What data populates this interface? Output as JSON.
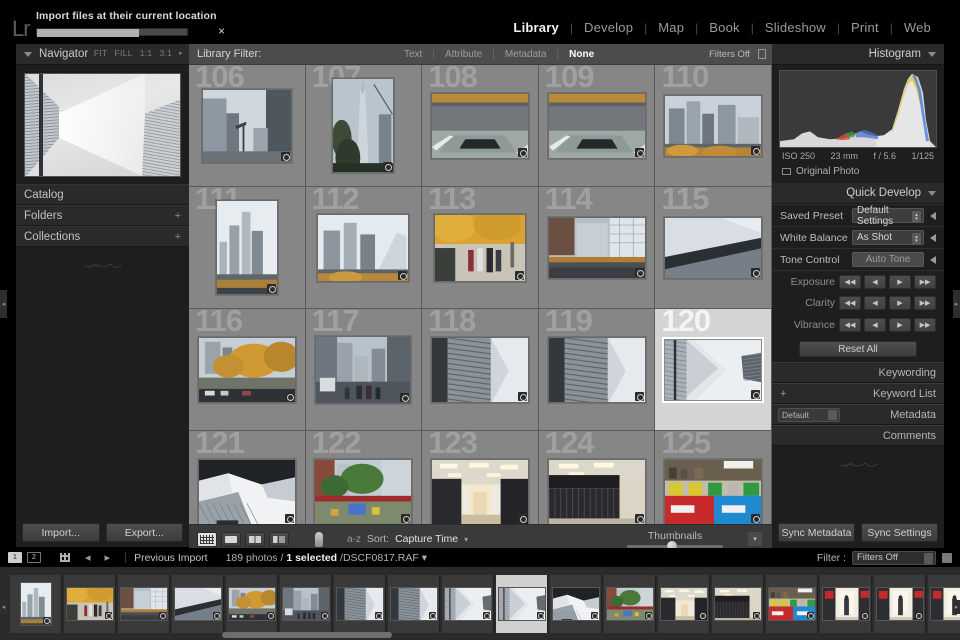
{
  "app": {
    "logo": "Lr"
  },
  "import_status": {
    "label": "Import files at their current location",
    "progress_percent": 68,
    "close_icon": "×"
  },
  "modules": {
    "items": [
      {
        "label": "Library",
        "active": true
      },
      {
        "label": "Develop",
        "active": false
      },
      {
        "label": "Map",
        "active": false
      },
      {
        "label": "Book",
        "active": false
      },
      {
        "label": "Slideshow",
        "active": false
      },
      {
        "label": "Print",
        "active": false
      },
      {
        "label": "Web",
        "active": false
      }
    ],
    "separator": "|"
  },
  "left_panel": {
    "navigator": {
      "title": "Navigator",
      "zoom_levels": [
        "FIT",
        "FILL",
        "1:1",
        "3:1"
      ],
      "more_arrow": "▸"
    },
    "sections": [
      {
        "label": "Catalog",
        "plus": ""
      },
      {
        "label": "Folders",
        "plus": "+"
      },
      {
        "label": "Collections",
        "plus": "+"
      }
    ],
    "buttons": {
      "import": "Import...",
      "export": "Export..."
    }
  },
  "library_filter": {
    "label": "Library Filter:",
    "tabs": [
      {
        "label": "Text",
        "active": false
      },
      {
        "label": "Attribute",
        "active": false
      },
      {
        "label": "Metadata",
        "active": false
      },
      {
        "label": "None",
        "active": true
      }
    ],
    "filters_off": "Filters Off"
  },
  "grid": {
    "cells": [
      {
        "index": "106",
        "selected": false,
        "kind": "buildings-crane"
      },
      {
        "index": "107",
        "selected": false,
        "kind": "tower-portrait"
      },
      {
        "index": "108",
        "selected": false,
        "kind": "memorial-pool"
      },
      {
        "index": "109",
        "selected": false,
        "kind": "memorial-pool"
      },
      {
        "index": "110",
        "selected": false,
        "kind": "skyline-autumn"
      },
      {
        "index": "111",
        "selected": false,
        "kind": "towers-portrait"
      },
      {
        "index": "112",
        "selected": false,
        "kind": "towers-wide"
      },
      {
        "index": "113",
        "selected": false,
        "kind": "walkway-people"
      },
      {
        "index": "114",
        "selected": false,
        "kind": "glass-facade"
      },
      {
        "index": "115",
        "selected": false,
        "kind": "abstract-wedge"
      },
      {
        "index": "116",
        "selected": false,
        "kind": "autumn-trees"
      },
      {
        "index": "117",
        "selected": false,
        "kind": "street-crowd"
      },
      {
        "index": "118",
        "selected": false,
        "kind": "museum-angle"
      },
      {
        "index": "119",
        "selected": false,
        "kind": "museum-angle"
      },
      {
        "index": "120",
        "selected": true,
        "kind": "sky-wedge"
      },
      {
        "index": "121",
        "selected": false,
        "kind": "upward-abstract"
      },
      {
        "index": "122",
        "selected": false,
        "kind": "park-plaza"
      },
      {
        "index": "123",
        "selected": false,
        "kind": "store-aisle"
      },
      {
        "index": "124",
        "selected": false,
        "kind": "store-racks"
      },
      {
        "index": "125",
        "selected": false,
        "kind": "shop-colors"
      }
    ]
  },
  "toolbar": {
    "view_modes": [
      "grid-view",
      "loupe-view",
      "compare-view",
      "survey-view"
    ],
    "painter_icon": "painter-icon",
    "sort_label": "Sort:",
    "sort_value": "Capture Time",
    "sort_caret": "▾",
    "thumbnails_label": "Thumbnails",
    "thumbnail_size_percent": 42,
    "az_icon": "a-z"
  },
  "right_panel": {
    "histogram": {
      "title": "Histogram",
      "iso": "ISO 250",
      "focal": "23 mm",
      "aperture": "f / 5.6",
      "shutter": "1/125",
      "original_photo": "Original Photo"
    },
    "quick_develop": {
      "title": "Quick Develop",
      "saved_preset_label": "Saved Preset",
      "saved_preset_value": "Default Settings",
      "white_balance_label": "White Balance",
      "white_balance_value": "As Shot",
      "tone_control_label": "Tone Control",
      "auto_tone_label": "Auto Tone",
      "exposure_label": "Exposure",
      "clarity_label": "Clarity",
      "vibrance_label": "Vibrance",
      "nudges": [
        "◀◀",
        "◀",
        "▶",
        "▶▶"
      ],
      "reset_all": "Reset All"
    },
    "sections": [
      {
        "label": "Keywording",
        "lead": ""
      },
      {
        "label": "Keyword List",
        "lead": "+"
      },
      {
        "label": "Metadata",
        "lead": "Default"
      },
      {
        "label": "Comments",
        "lead": ""
      }
    ],
    "sync": {
      "metadata": "Sync Metadata",
      "settings": "Sync Settings"
    }
  },
  "filmstrip_bar": {
    "source": "Previous Import",
    "count_prefix": "189 photos /",
    "count_selected": "1 selected",
    "count_file": "/DSCF0817.RAF",
    "count_caret": "▾",
    "filter_label": "Filter :",
    "filter_value": "Filters Off",
    "nav_back": "◂",
    "nav_forward": "▸"
  },
  "filmstrip": {
    "thumbs": [
      {
        "kind": "towers-portrait",
        "selected": false
      },
      {
        "kind": "walkway-people",
        "selected": false
      },
      {
        "kind": "glass-facade",
        "selected": false
      },
      {
        "kind": "abstract-wedge",
        "selected": false
      },
      {
        "kind": "autumn-trees",
        "selected": false
      },
      {
        "kind": "street-crowd",
        "selected": false
      },
      {
        "kind": "museum-angle",
        "selected": false
      },
      {
        "kind": "museum-angle",
        "selected": false
      },
      {
        "kind": "sky-wedge",
        "selected": false
      },
      {
        "kind": "sky-wedge",
        "selected": true
      },
      {
        "kind": "upward-abstract",
        "selected": false
      },
      {
        "kind": "park-plaza",
        "selected": false
      },
      {
        "kind": "store-aisle",
        "selected": false
      },
      {
        "kind": "store-racks",
        "selected": false
      },
      {
        "kind": "shop-colors",
        "selected": false
      },
      {
        "kind": "corridor-person",
        "selected": false
      },
      {
        "kind": "corridor-person",
        "selected": false
      },
      {
        "kind": "corridor-person",
        "selected": false
      },
      {
        "kind": "corridor-person",
        "selected": false
      }
    ]
  },
  "colors": {
    "background": "#000000",
    "panel": "#1e1e1e",
    "panel_header": "#2a2a2a",
    "grid_bg": "#565656",
    "cell_bg": "#868686",
    "cell_selected": "#d4d4d4",
    "accent_text": "#f2f2f2"
  }
}
